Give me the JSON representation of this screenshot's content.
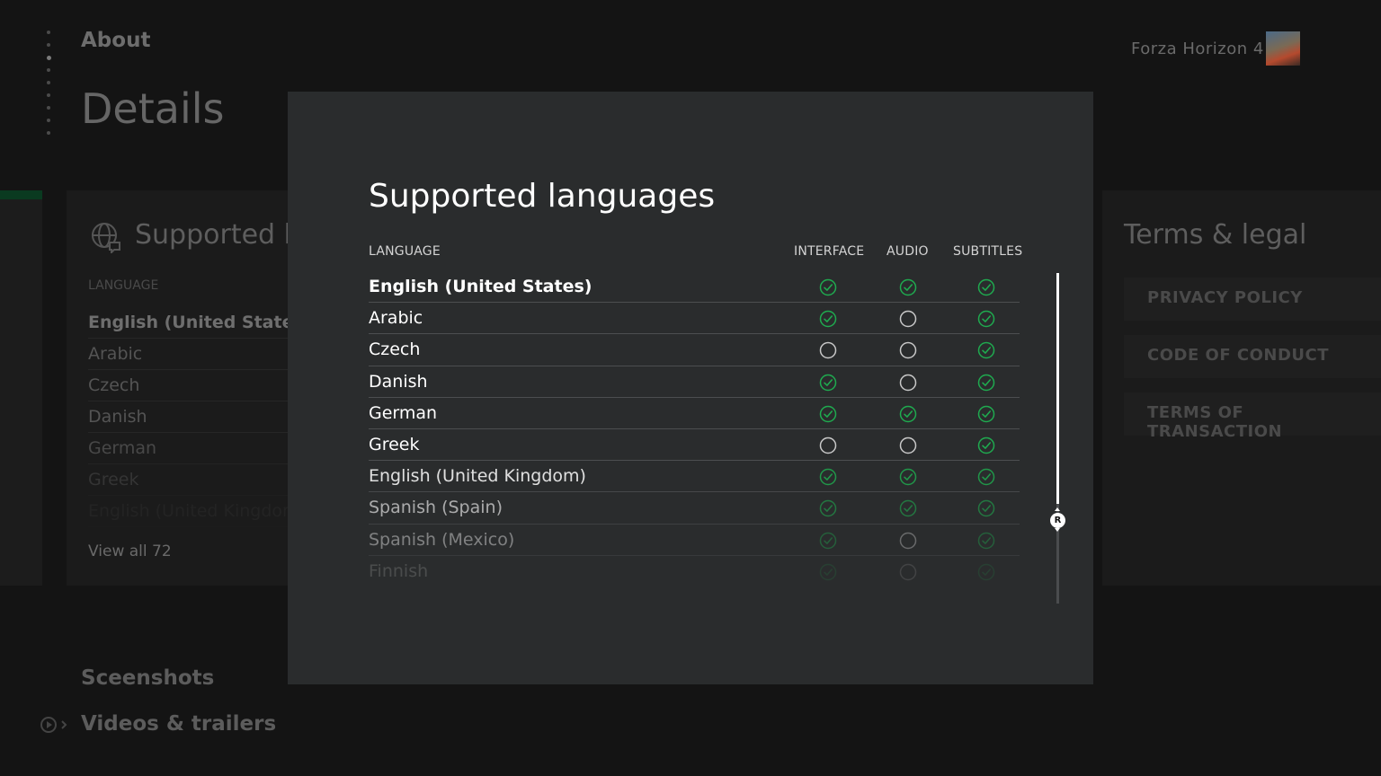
{
  "background": {
    "section_label": "About",
    "page_title": "Details",
    "game_name": "Forza Horizon 4",
    "left_card": {
      "title": "Supported languages",
      "column_header": "LANGUAGE",
      "rows": [
        "English (United States)",
        "Arabic",
        "Czech",
        "Danish",
        "German",
        "Greek",
        "English (United Kingdom)"
      ],
      "view_all": "View all 72"
    },
    "right_card": {
      "title": "Terms & legal",
      "buttons": [
        "PRIVACY POLICY",
        "CODE OF CONDUCT",
        "TERMS OF TRANSACTION"
      ]
    },
    "screenshots_label": "Sceenshots",
    "videos_label": "Videos & trailers"
  },
  "dialog": {
    "title": "Supported languages",
    "headers": {
      "language": "LANGUAGE",
      "interface": "INTERFACE",
      "audio": "AUDIO",
      "subtitles": "SUBTITLES"
    },
    "scroll_button_glyph": "R",
    "rows": [
      {
        "language": "English (United States)",
        "interface": true,
        "audio": true,
        "subtitles": true,
        "opacity": 1.0,
        "bold": true
      },
      {
        "language": "Arabic",
        "interface": true,
        "audio": false,
        "subtitles": true,
        "opacity": 1.0
      },
      {
        "language": "Czech",
        "interface": false,
        "audio": false,
        "subtitles": true,
        "opacity": 1.0
      },
      {
        "language": "Danish",
        "interface": true,
        "audio": false,
        "subtitles": true,
        "opacity": 1.0
      },
      {
        "language": "German",
        "interface": true,
        "audio": true,
        "subtitles": true,
        "opacity": 1.0
      },
      {
        "language": "Greek",
        "interface": false,
        "audio": false,
        "subtitles": true,
        "opacity": 1.0
      },
      {
        "language": "English (United Kingdom)",
        "interface": true,
        "audio": true,
        "subtitles": true,
        "opacity": 0.85
      },
      {
        "language": "Spanish (Spain)",
        "interface": true,
        "audio": true,
        "subtitles": true,
        "opacity": 0.6
      },
      {
        "language": "Spanish (Mexico)",
        "interface": true,
        "audio": false,
        "subtitles": true,
        "opacity": 0.4
      },
      {
        "language": "Finnish",
        "interface": true,
        "audio": false,
        "subtitles": true,
        "opacity": 0.15
      }
    ]
  },
  "colors": {
    "check": "#1faa4f",
    "unchecked": "#c8c8c8",
    "dialog_bg": "#2a2c2d"
  }
}
